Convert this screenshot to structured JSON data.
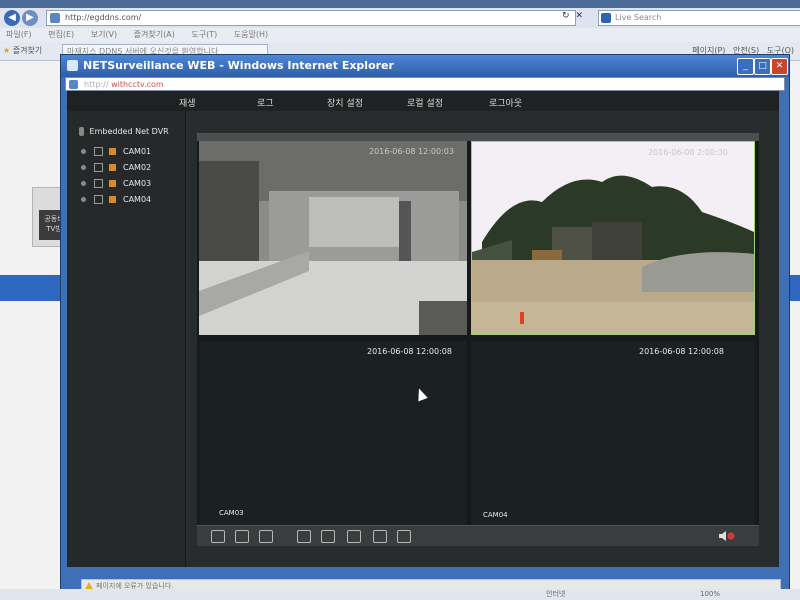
{
  "outer_browser": {
    "url": "http://egddns.com/",
    "search_placeholder": "Live Search",
    "menu": [
      "파일(F)",
      "편집(E)",
      "보기(V)",
      "즐겨찾기(A)",
      "도구(T)",
      "도움말(H)"
    ],
    "favorites_label": "즐겨찾기",
    "tab_title": "마재지스 DDNS 서버에 오신것을 환영합니다",
    "right_tools": [
      "페이지(P)",
      "안전(S)",
      "도구(O)"
    ],
    "thumb_text": "공동비 TV방",
    "status_zone": "인터넷",
    "status_zoom": "100%"
  },
  "popup": {
    "title": "NETSurveillance WEB - Windows Internet Explorer",
    "address_prefix": "http://",
    "address_host": "withcctv.com",
    "status_text": "페이지에 오류가 있습니다.",
    "window_buttons": {
      "min": "minimize",
      "max": "maximize",
      "close": "close"
    }
  },
  "viewer": {
    "menu": [
      "재생",
      "로그",
      "장치 설정",
      "로컬 설정",
      "로그아웃"
    ],
    "tree_root": "Embedded Net DVR",
    "cameras": [
      "CAM01",
      "CAM02",
      "CAM03",
      "CAM04"
    ],
    "feeds": {
      "cam1_overlay_ts": "2016-06-08 12:00:03",
      "cam2_overlay_ts": "2016-06-08 2:00:30",
      "cam1_bottom_ts": "2016-06-08 12:00:08",
      "cam2_bottom_ts": "2016-06-08 12:00:08",
      "cam3_label": "CAM03",
      "cam4_label": "CAM04"
    },
    "toolbar_icons": [
      "fullscreen-icon",
      "single-view-icon",
      "quad-view-icon",
      "record-icon",
      "snapshot-icon",
      "list-icon",
      "playback-icon",
      "settings-icon"
    ],
    "colors": {
      "accent": "#d78a28",
      "selected_border": "#9fd06a",
      "mute": "#d23a3a"
    }
  }
}
